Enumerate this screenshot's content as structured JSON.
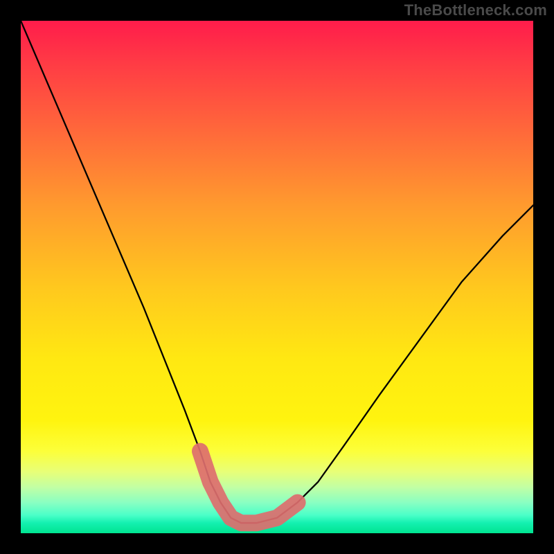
{
  "watermark": {
    "text": "TheBottleneck.com"
  },
  "chart_data": {
    "type": "line",
    "title": "",
    "xlabel": "",
    "ylabel": "",
    "xlim": [
      0,
      100
    ],
    "ylim": [
      0,
      100
    ],
    "grid": false,
    "legend": false,
    "series": [
      {
        "name": "curve",
        "color": "#000000",
        "x": [
          0,
          6,
          12,
          18,
          24,
          28,
          32,
          35,
          37,
          39,
          41,
          43,
          46,
          50,
          54,
          58,
          63,
          70,
          78,
          86,
          94,
          100
        ],
        "values": [
          100,
          86,
          72,
          58,
          44,
          34,
          24,
          16,
          10,
          6,
          3,
          2,
          2,
          3,
          6,
          10,
          17,
          27,
          38,
          49,
          58,
          64
        ]
      },
      {
        "name": "highlight",
        "color": "#dd6e6e",
        "x": [
          35,
          37,
          39,
          41,
          43,
          46,
          50,
          54
        ],
        "values": [
          16,
          10,
          6,
          3,
          2,
          2,
          3,
          6
        ]
      }
    ],
    "background_gradient": {
      "top": "#ff1c4b",
      "mid": "#fff40f",
      "bottom": "#00e490"
    }
  }
}
